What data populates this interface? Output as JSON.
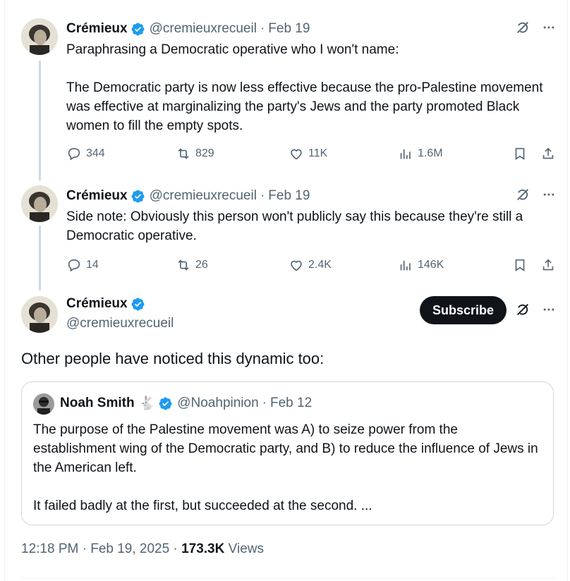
{
  "colors": {
    "text": "#0f1419",
    "secondary": "#536471",
    "verified": "#1d9bf0",
    "border": "#cfd9de"
  },
  "tweets": [
    {
      "name": "Crémieux",
      "handle": "@cremieuxrecueil",
      "separator": "·",
      "date": "Feb 19",
      "paragraphs": [
        "Paraphrasing a Democratic operative who I won't name:",
        "The Democratic party is now less effective because the pro-Palestine movement was effective at marginalizing the party's Jews and the party promoted Black women to fill the empty spots."
      ],
      "replies": "344",
      "reposts": "829",
      "likes": "11K",
      "views": "1.6M"
    },
    {
      "name": "Crémieux",
      "handle": "@cremieuxrecueil",
      "separator": "·",
      "date": "Feb 19",
      "paragraphs": [
        "Side note: Obviously this person won't publicly say this because they're still a Democratic operative."
      ],
      "replies": "14",
      "reposts": "26",
      "likes": "2.4K",
      "views": "146K"
    }
  ],
  "main": {
    "name": "Crémieux",
    "handle": "@cremieuxrecueil",
    "subscribe_label": "Subscribe",
    "text": "Other people have noticed this dynamic too:",
    "quote": {
      "name": "Noah Smith",
      "emoji": "🐇",
      "handle": "@Noahpinion",
      "separator": "·",
      "date": "Feb 12",
      "paragraphs": [
        "The purpose of the Palestine movement was A) to seize power from the establishment wing of the Democratic party, and B) to reduce the influence of Jews in the American left.",
        "It failed badly at the first, but succeeded at the second. ..."
      ]
    },
    "time": "12:18 PM · Feb 19, 2025 ·",
    "views_count": "173.3K",
    "views_label": "Views"
  },
  "icons": [
    "verified-badge-icon",
    "grok-icon",
    "more-icon",
    "reply-icon",
    "repost-icon",
    "like-icon",
    "views-icon",
    "bookmark-icon",
    "share-icon"
  ]
}
